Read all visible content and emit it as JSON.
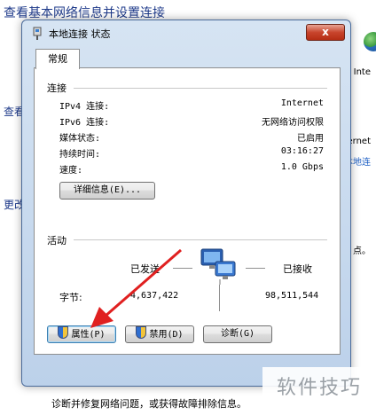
{
  "background": {
    "title": "查看基本网络信息并设置连接",
    "left_labels": [
      "查看",
      "更改"
    ],
    "right_texts": [
      "Inte",
      "ternet",
      "本地连",
      "点。"
    ],
    "bottom_text": "诊断并修复网络问题，或获得故障排除信息。",
    "watermark": "软件技巧"
  },
  "dialog": {
    "title": "本地连接 状态",
    "close_glyph": "x",
    "tab": "常规",
    "connection": {
      "heading": "连接",
      "rows": [
        {
          "label": "IPv4 连接:",
          "value": "Internet"
        },
        {
          "label": "IPv6 连接:",
          "value": "无网络访问权限"
        },
        {
          "label": "媒体状态:",
          "value": "已启用"
        },
        {
          "label": "持续时间:",
          "value": "03:16:27"
        },
        {
          "label": "速度:",
          "value": "1.0 Gbps"
        }
      ],
      "details_button": "详细信息(E)..."
    },
    "activity": {
      "heading": "活动",
      "sent_label": "已发送",
      "received_label": "已接收",
      "bytes_label": "字节:",
      "sent_bytes": "4,637,422",
      "received_bytes": "98,511,544"
    },
    "buttons": {
      "properties": "属性(P)",
      "disable": "禁用(D)",
      "diagnose": "诊断(G)"
    }
  },
  "colors": {
    "accent_arrow": "#e02020",
    "link": "#1d5fc4",
    "window_frame": "#bcd1ea"
  },
  "icons": [
    "network-adapter-icon",
    "shield-icon",
    "network-computers-icon",
    "globe-icon"
  ]
}
